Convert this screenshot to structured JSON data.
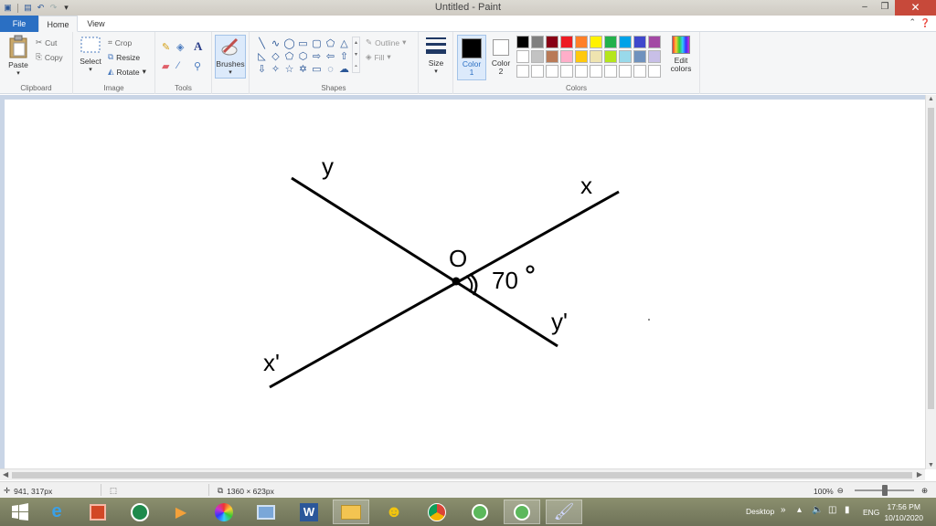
{
  "window": {
    "title": "Untitled - Paint"
  },
  "tabs": {
    "file": "File",
    "home": "Home",
    "view": "View"
  },
  "ribbon": {
    "clipboard": {
      "paste": "Paste",
      "cut": "Cut",
      "copy": "Copy",
      "group": "Clipboard"
    },
    "image": {
      "select": "Select",
      "crop": "Crop",
      "resize": "Resize",
      "rotate": "Rotate",
      "group": "Image"
    },
    "tools": {
      "group": "Tools",
      "text_tool": "A"
    },
    "brushes": {
      "label": "Brushes"
    },
    "shapes": {
      "outline": "Outline",
      "fill": "Fill",
      "group": "Shapes"
    },
    "size": {
      "label": "Size"
    },
    "colors": {
      "color1_label": "Color",
      "color1_num": "1",
      "color2_label": "Color",
      "color2_num": "2",
      "edit_label": "Edit colors",
      "group": "Colors",
      "palette": [
        "#000000",
        "#7f7f7f",
        "#880015",
        "#ed1c24",
        "#ff7f27",
        "#fff200",
        "#22b14c",
        "#00a2e8",
        "#3f48cc",
        "#a349a4",
        "#ffffff",
        "#c3c3c3",
        "#b97a57",
        "#ffaec9",
        "#ffc90e",
        "#efe4b0",
        "#b5e61d",
        "#99d9ea",
        "#7092be",
        "#c8bfe7",
        "#ffffff",
        "#ffffff",
        "#ffffff",
        "#ffffff",
        "#ffffff",
        "#ffffff",
        "#ffffff",
        "#ffffff",
        "#ffffff",
        "#ffffff"
      ]
    }
  },
  "drawing": {
    "label_y": "y",
    "label_x": "x",
    "label_o": "O",
    "label_angle": "70",
    "label_yprime": "y'",
    "label_xprime": "x'"
  },
  "status": {
    "cursor_pos": "941, 317px",
    "canvas_size": "1360 × 623px",
    "zoom": "100%"
  },
  "taskbar": {
    "desktop": "Desktop",
    "language": "ENG",
    "time": "17:56 PM",
    "date": "10/10/2020"
  }
}
